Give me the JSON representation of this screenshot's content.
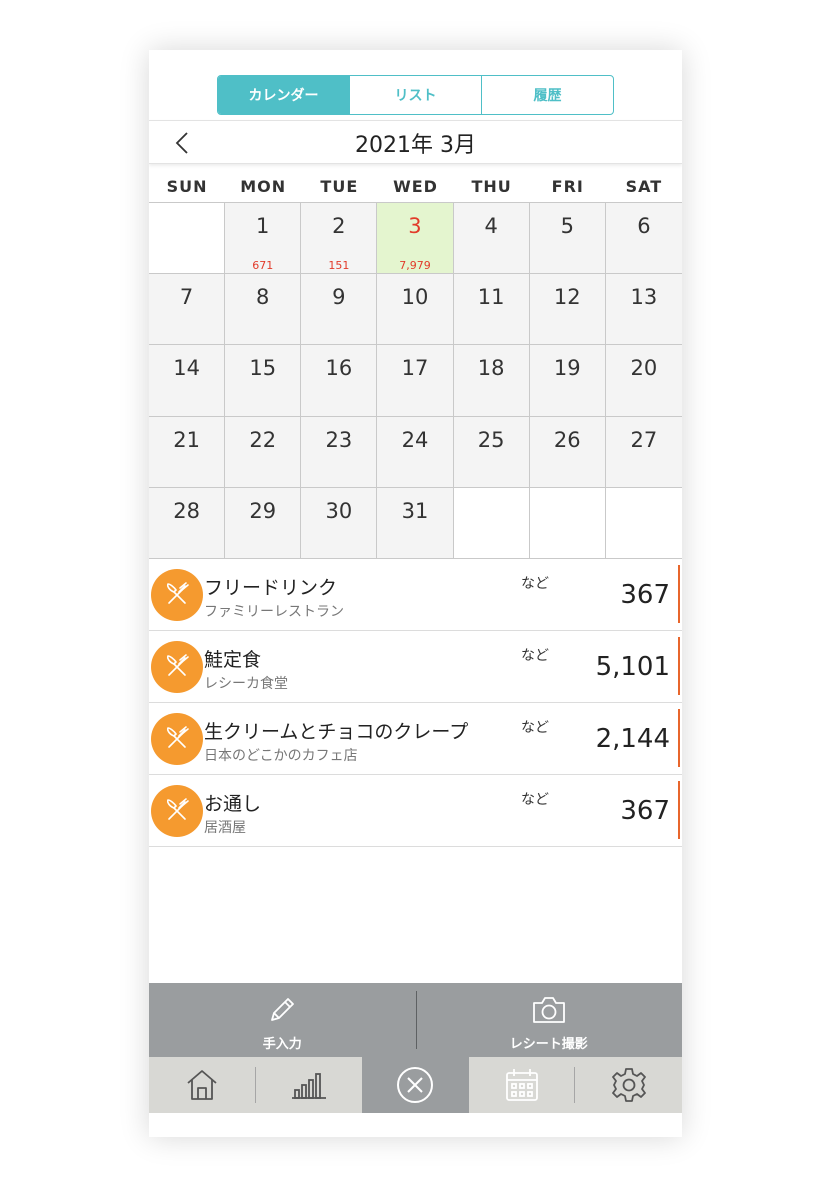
{
  "segment": {
    "tabs": [
      {
        "label": "カレンダー",
        "active": true
      },
      {
        "label": "リスト",
        "active": false
      },
      {
        "label": "履歴",
        "active": false
      }
    ]
  },
  "calendar": {
    "title": "2021年 3月",
    "weekdays": [
      "SUN",
      "MON",
      "TUE",
      "WED",
      "THU",
      "FRI",
      "SAT"
    ],
    "today": "3",
    "days": [
      {
        "day": "",
        "amount": ""
      },
      {
        "day": "1",
        "amount": "671"
      },
      {
        "day": "2",
        "amount": "151"
      },
      {
        "day": "3",
        "amount": "7,979"
      },
      {
        "day": "4",
        "amount": ""
      },
      {
        "day": "5",
        "amount": ""
      },
      {
        "day": "6",
        "amount": ""
      },
      {
        "day": "7",
        "amount": ""
      },
      {
        "day": "8",
        "amount": ""
      },
      {
        "day": "9",
        "amount": ""
      },
      {
        "day": "10",
        "amount": ""
      },
      {
        "day": "11",
        "amount": ""
      },
      {
        "day": "12",
        "amount": ""
      },
      {
        "day": "13",
        "amount": ""
      },
      {
        "day": "14",
        "amount": ""
      },
      {
        "day": "15",
        "amount": ""
      },
      {
        "day": "16",
        "amount": ""
      },
      {
        "day": "17",
        "amount": ""
      },
      {
        "day": "18",
        "amount": ""
      },
      {
        "day": "19",
        "amount": ""
      },
      {
        "day": "20",
        "amount": ""
      },
      {
        "day": "21",
        "amount": ""
      },
      {
        "day": "22",
        "amount": ""
      },
      {
        "day": "23",
        "amount": ""
      },
      {
        "day": "24",
        "amount": ""
      },
      {
        "day": "25",
        "amount": ""
      },
      {
        "day": "26",
        "amount": ""
      },
      {
        "day": "27",
        "amount": ""
      },
      {
        "day": "28",
        "amount": ""
      },
      {
        "day": "29",
        "amount": ""
      },
      {
        "day": "30",
        "amount": ""
      },
      {
        "day": "31",
        "amount": ""
      },
      {
        "day": "",
        "amount": ""
      },
      {
        "day": "",
        "amount": ""
      },
      {
        "day": "",
        "amount": ""
      }
    ]
  },
  "receipts": [
    {
      "item": "フリードリンク",
      "shop": "ファミリーレストラン",
      "etc": "など",
      "price": "367",
      "icon": "fork-knife-icon"
    },
    {
      "item": "鮭定食",
      "shop": "レシーカ食堂",
      "etc": "など",
      "price": "5,101",
      "icon": "fork-knife-icon"
    },
    {
      "item": "生クリームとチョコのクレープ",
      "shop": "日本のどこかのカフェ店",
      "etc": "など",
      "price": "2,144",
      "icon": "fork-knife-icon"
    },
    {
      "item": "お通し",
      "shop": "居酒屋",
      "etc": "など",
      "price": "367",
      "icon": "fork-knife-icon"
    }
  ],
  "actions": {
    "manual_label": "手入力",
    "camera_label": "レシート撮影"
  },
  "tabbar": {
    "icons": [
      "home-icon",
      "bar-chart-icon",
      "close-circle-icon",
      "calendar-icon",
      "gear-icon"
    ]
  },
  "colors": {
    "accent": "#4fbfc7",
    "today_bg": "#e4f5cf",
    "amount_text": "#e23b2a",
    "category": "#f59a2f",
    "price_accent": "#e8662c",
    "action_bar": "#9a9d9f",
    "tab_bar": "#d8d8d4"
  }
}
